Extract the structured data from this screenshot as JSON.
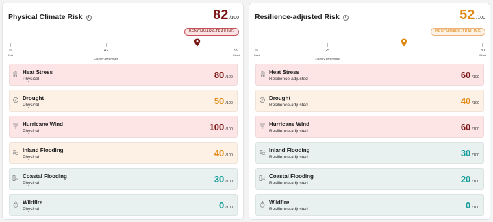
{
  "colors": {
    "high": "#7a1616",
    "medium": "#e08a12",
    "low": "#159d9a",
    "badge_red_border": "#c6525a",
    "badge_red_bg": "#fbe3e4",
    "badge_orange_border": "#efb27a",
    "badge_orange_bg": "#fdf1e6"
  },
  "panels": [
    {
      "title": "Physical Climate Risk",
      "info_icon": "info-icon",
      "score": "82",
      "score_suffix": "/100",
      "score_level": "high",
      "badge": "BENCHMARK-TRAILING",
      "badge_style": "red",
      "scale": {
        "min_label": "0",
        "benchmark_label": "42",
        "max_label": "99",
        "best_label": "Best",
        "worst_label": "Worst",
        "benchmark_caption": "Country Benchmark",
        "scale_max": 99,
        "benchmark_value": 42,
        "marker_value": 82
      },
      "items": [
        {
          "name": "Heat Stress",
          "subtitle": "Physical",
          "value": "80",
          "suffix": "/100",
          "level": "high",
          "icon": "thermometer-icon"
        },
        {
          "name": "Drought",
          "subtitle": "Physical",
          "value": "50",
          "suffix": "/100",
          "level": "medium",
          "icon": "drought-icon"
        },
        {
          "name": "Hurricane Wind",
          "subtitle": "Physical",
          "value": "100",
          "suffix": "/100",
          "level": "high",
          "icon": "hurricane-icon"
        },
        {
          "name": "Inland Flooding",
          "subtitle": "Physical",
          "value": "40",
          "suffix": "/100",
          "level": "medium",
          "icon": "flood-waves-icon"
        },
        {
          "name": "Coastal Flooding",
          "subtitle": "Physical",
          "value": "30",
          "suffix": "/100",
          "level": "low",
          "icon": "coastal-flood-icon"
        },
        {
          "name": "Wildfire",
          "subtitle": "Physical",
          "value": "0",
          "suffix": "/100",
          "level": "low",
          "icon": "flame-icon"
        }
      ]
    },
    {
      "title": "Resilience-adjusted Risk",
      "info_icon": "info-icon",
      "score": "52",
      "score_suffix": "/100",
      "score_level": "medium",
      "badge": "BENCHMARK-TRAILING",
      "badge_style": "orange",
      "scale": {
        "min_label": "0",
        "benchmark_label": "25",
        "max_label": "80",
        "best_label": "Best",
        "worst_label": "Worst",
        "benchmark_caption": "Country Benchmark",
        "scale_max": 80,
        "benchmark_value": 25,
        "marker_value": 52
      },
      "items": [
        {
          "name": "Heat Stress",
          "subtitle": "Resilience-adjusted",
          "value": "60",
          "suffix": "/100",
          "level": "high",
          "icon": "thermometer-icon"
        },
        {
          "name": "Drought",
          "subtitle": "Resilience-adjusted",
          "value": "40",
          "suffix": "/100",
          "level": "medium",
          "icon": "drought-icon"
        },
        {
          "name": "Hurricane Wind",
          "subtitle": "Resilience-adjusted",
          "value": "60",
          "suffix": "/100",
          "level": "high",
          "icon": "hurricane-icon"
        },
        {
          "name": "Inland Flooding",
          "subtitle": "Resilience-adjusted",
          "value": "30",
          "suffix": "/100",
          "level": "low",
          "icon": "flood-waves-icon"
        },
        {
          "name": "Coastal Flooding",
          "subtitle": "Resilience-adjusted",
          "value": "20",
          "suffix": "/100",
          "level": "low",
          "icon": "coastal-flood-icon"
        },
        {
          "name": "Wildfire",
          "subtitle": "Resilience-adjusted",
          "value": "0",
          "suffix": "/100",
          "level": "low",
          "icon": "flame-icon"
        }
      ]
    }
  ]
}
